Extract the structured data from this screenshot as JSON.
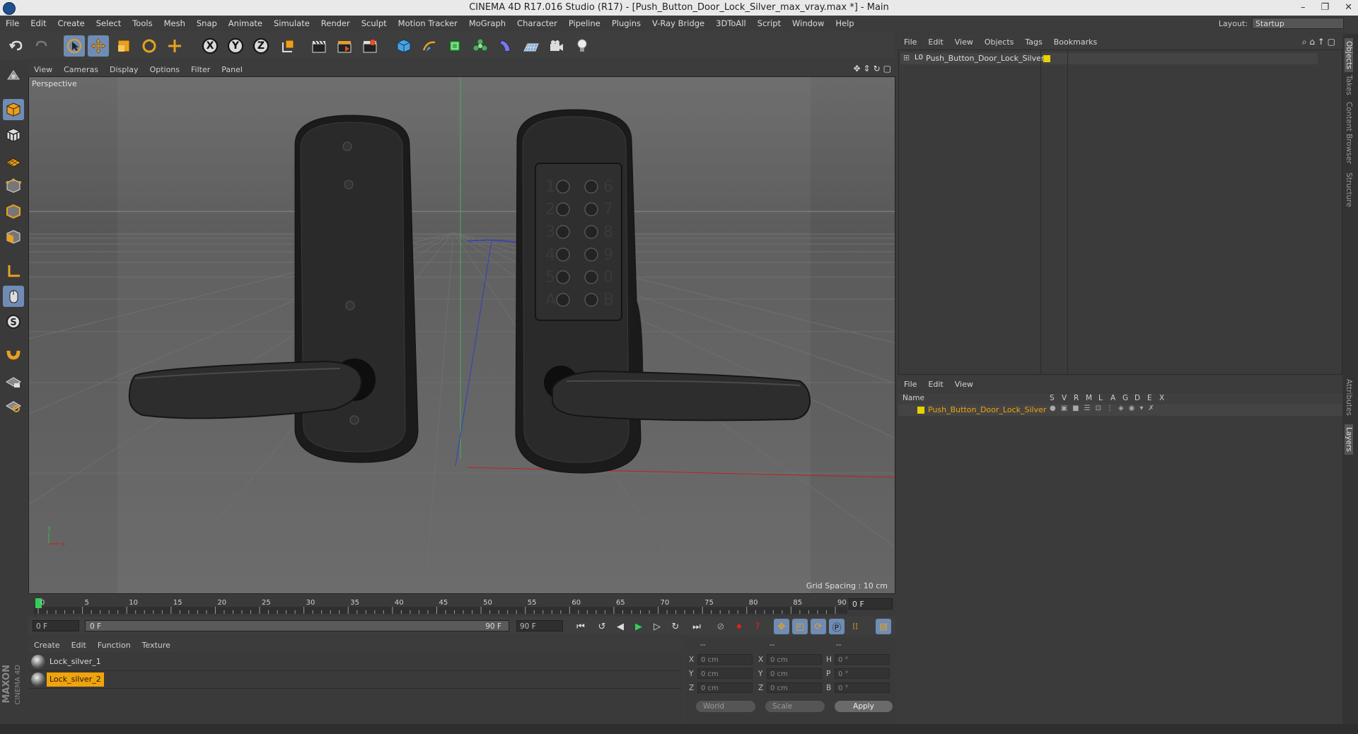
{
  "window": {
    "title": "CINEMA 4D R17.016 Studio (R17) - [Push_Button_Door_Lock_Silver_max_vray.max *] - Main",
    "controls": [
      "–",
      "❐",
      "✕"
    ]
  },
  "menubar": {
    "items": [
      "File",
      "Edit",
      "Create",
      "Select",
      "Tools",
      "Mesh",
      "Snap",
      "Animate",
      "Simulate",
      "Render",
      "Sculpt",
      "Motion Tracker",
      "MoGraph",
      "Character",
      "Pipeline",
      "Plugins",
      "V-Ray Bridge",
      "3DToAll",
      "Script",
      "Window",
      "Help"
    ],
    "layout_label": "Layout:",
    "layout_value": "Startup"
  },
  "toolbar": {
    "axis_x": "X",
    "axis_y": "Y",
    "axis_z": "Z"
  },
  "viewport": {
    "menu": [
      "View",
      "Cameras",
      "Display",
      "Options",
      "Filter",
      "Panel"
    ],
    "label": "Perspective",
    "grid_spacing": "Grid Spacing : 10 cm",
    "axis_y": "y",
    "axis_x": "x",
    "keypad_left": [
      "1",
      "2",
      "3",
      "4",
      "5",
      "A"
    ],
    "keypad_right": [
      "6",
      "7",
      "8",
      "9",
      "0",
      "B"
    ]
  },
  "timeline": {
    "ticks": [
      "0",
      "5",
      "10",
      "15",
      "20",
      "25",
      "30",
      "35",
      "40",
      "45",
      "50",
      "55",
      "60",
      "65",
      "70",
      "75",
      "80",
      "85",
      "90"
    ],
    "current_frame": "0 F",
    "start_field": "0 F",
    "range_start": "0 F",
    "range_end": "90 F",
    "end_field": "90 F"
  },
  "materials": {
    "menu": [
      "Create",
      "Edit",
      "Function",
      "Texture"
    ],
    "items": [
      {
        "name": "Lock_silver_1",
        "selected": false
      },
      {
        "name": "Lock_silver_2",
        "selected": true
      }
    ]
  },
  "coords": {
    "headers": [
      "--",
      "--",
      "--"
    ],
    "rows": [
      {
        "a": "X",
        "av": "0 cm",
        "b": "X",
        "bv": "0 cm",
        "c": "H",
        "cv": "0 °"
      },
      {
        "a": "Y",
        "av": "0 cm",
        "b": "Y",
        "bv": "0 cm",
        "c": "P",
        "cv": "0 °"
      },
      {
        "a": "Z",
        "av": "0 cm",
        "b": "Z",
        "bv": "0 cm",
        "c": "B",
        "cv": "0 °"
      }
    ],
    "world": "World",
    "scale": "Scale",
    "apply": "Apply"
  },
  "objects": {
    "menu": [
      "File",
      "Edit",
      "View",
      "Objects",
      "Tags",
      "Bookmarks"
    ],
    "root": "Push_Button_Door_Lock_Silver",
    "root_icon": "L0"
  },
  "layers": {
    "menu": [
      "File",
      "Edit",
      "View"
    ],
    "headers": [
      "Name",
      "S",
      "V",
      "R",
      "M",
      "L",
      "A",
      "G",
      "D",
      "E",
      "X"
    ],
    "row": "Push_Button_Door_Lock_Silver"
  },
  "side_tabs": [
    "Objects",
    "Takes",
    "Content Browser",
    "Structure",
    "Attributes",
    "Layers"
  ],
  "brand": {
    "line1": "MAXON",
    "line2": "CINEMA 4D"
  },
  "colors": {
    "accent_blue": "#6f8cb5",
    "selection_orange": "#f0a30a",
    "tag_yellow": "#e8d200"
  }
}
